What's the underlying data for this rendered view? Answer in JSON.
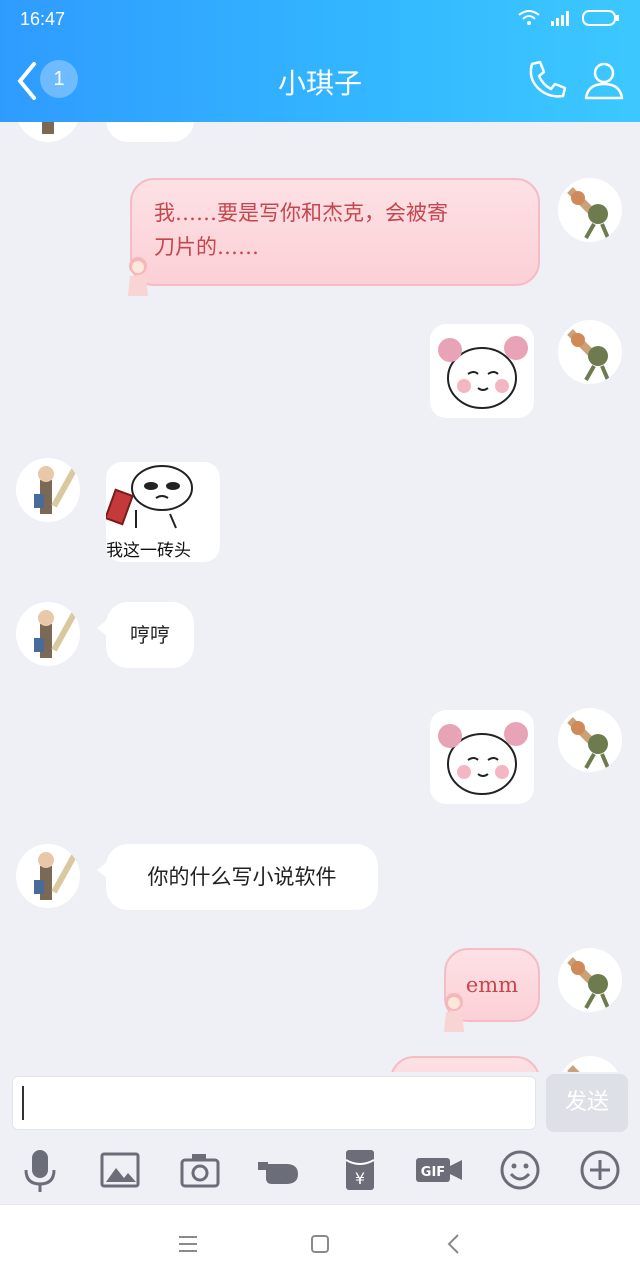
{
  "status": {
    "time": "16:47"
  },
  "header": {
    "title": "小琪子",
    "unread_badge": "1"
  },
  "messages": [
    {
      "side": "right",
      "type": "text",
      "text_line1": "我……要是写你和杰克，会被寄",
      "text_line2": "刀片的……"
    },
    {
      "side": "right",
      "type": "sticker",
      "sticker": "blushing-face-sticker"
    },
    {
      "side": "left",
      "type": "sticker",
      "sticker": "brick-sticker",
      "caption": "我这一砖头"
    },
    {
      "side": "left",
      "type": "text",
      "text": "哼哼"
    },
    {
      "side": "right",
      "type": "sticker",
      "sticker": "blushing-face-sticker"
    },
    {
      "side": "left",
      "type": "text",
      "text": "你的什么写小说软件"
    },
    {
      "side": "right",
      "type": "text",
      "text": "emm"
    }
  ],
  "input": {
    "value": "",
    "send_label": "发送"
  },
  "toolbar": [
    "microphone-icon",
    "image-icon",
    "camera-icon",
    "poke-icon",
    "red-packet-icon",
    "gif-icon",
    "emoji-icon",
    "plus-icon"
  ],
  "colors": {
    "header_start": "#2f9bff",
    "header_end": "#3cc8ff",
    "bubble_right": "#fbd0d6",
    "bubble_right_text": "#c4474d",
    "background": "#eef0f6"
  }
}
